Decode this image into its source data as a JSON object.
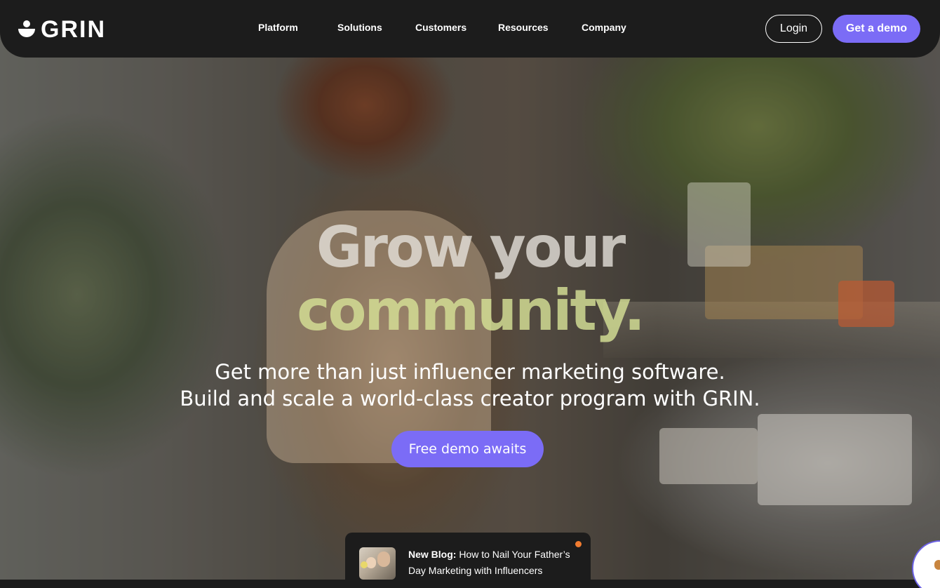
{
  "brand": {
    "name": "GRIN",
    "accent_color": "#7b6cf6",
    "nav_background": "#1c1c1c"
  },
  "nav": {
    "links": [
      {
        "label": "Platform"
      },
      {
        "label": "Solutions"
      },
      {
        "label": "Customers"
      },
      {
        "label": "Resources"
      },
      {
        "label": "Company"
      }
    ],
    "login_label": "Login",
    "demo_label": "Get a demo"
  },
  "hero": {
    "headline_line1": "Grow your",
    "headline_line2": "community.",
    "subhead_line1": "Get more than just influencer marketing software.",
    "subhead_line2": "Build and scale a world-class creator program with GRIN.",
    "cta_label": "Free demo awaits"
  },
  "blog_banner": {
    "label": "New Blog:",
    "title": "How to Nail Your Father’s Day Marketing with Influencers"
  },
  "icons": {
    "logo": "grin-smile-icon",
    "blog_thumbnail": "father-child-photo",
    "notification": "orange-dot-icon",
    "chat": "chat-widget-icon"
  }
}
